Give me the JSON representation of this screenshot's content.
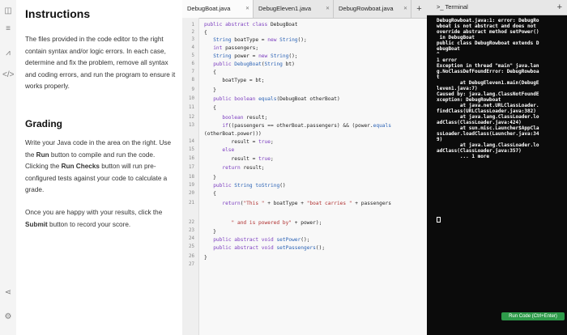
{
  "instructions": {
    "title": "Instructions",
    "p1": "The files provided in the code editor to the right contain syntax and/or logic errors. In each case, determine and fix the problem, remove all syntax and coding errors, and run the program to ensure it works properly.",
    "grading_title": "Grading",
    "p2_a": "Write your Java code in the area on the right. Use the ",
    "p2_run": "Run",
    "p2_b": " button to compile and run the code. Clicking the ",
    "p2_checks": "Run Checks",
    "p2_c": " button will run pre-configured tests against your code to calculate a grade.",
    "p3_a": "Once you are happy with your results, click the ",
    "p3_submit": "Submit",
    "p3_b": " button to record your score."
  },
  "tabs": [
    {
      "label": "DebugBoat.java"
    },
    {
      "label": "DebugEleven1.java"
    },
    {
      "label": "DebugRowboat.java"
    }
  ],
  "terminal": {
    "tab_label": "Terminal",
    "output": "DebugRowboat.java:1: error: DebugRo\nwboat is not abstract and does not\noverride abstract method setPower()\n in DebugBoat\npublic class DebugRowboat extends D\nebugBoat\n^\n1 error\nException in thread \"main\" java.lan\ng.NoClassDefFoundError: DebugRowboa\nt\n        at DebugEleven1.main(DebugE\nleven1.java:7)\nCaused by: java.lang.ClassNotFoundE\nxception: DebugRowboat\n        at java.net.URLClassLoader.\nfindClass(URLClassLoader.java:382)\n        at java.lang.ClassLoader.lo\nadClass(ClassLoader.java:424)\n        at sun.misc.Launcher$AppCla\nssLoader.loadClass(Launcher.java:34\n9)\n        at java.lang.ClassLoader.lo\nadClass(ClassLoader.java:357)\n        ... 1 more"
  },
  "run_button": "Run Code (Ctrl+Enter)"
}
